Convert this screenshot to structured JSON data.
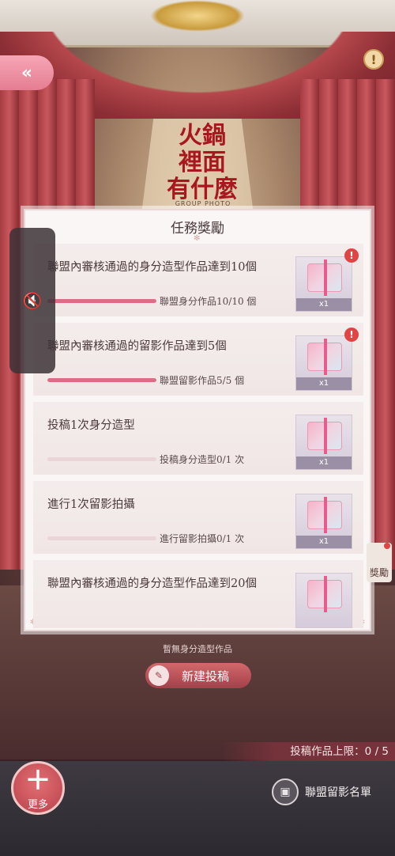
{
  "header": {
    "back_icon": "«",
    "info_icon": "!"
  },
  "logo": {
    "line1": "火鍋",
    "line2": "裡面",
    "line3": "有什麼",
    "sub": "GROUP PHOTO"
  },
  "panel": {
    "title": "任務獎勵",
    "tasks": [
      {
        "title": "聯盟內審核通過的身分造型作品達到10個",
        "progress_label": "聯盟身分作品10/10 個",
        "progress": 1.0,
        "reward_qty": "x1",
        "alert": "!"
      },
      {
        "title": "聯盟內審核通過的留影作品達到5個",
        "progress_label": "聯盟留影作品5/5 個",
        "progress": 1.0,
        "reward_qty": "x1",
        "alert": "!"
      },
      {
        "title": "投稿1次身分造型",
        "progress_label": "投稿身分造型0/1 次",
        "progress": 0.0,
        "reward_qty": "x1"
      },
      {
        "title": "進行1次留影拍攝",
        "progress_label": "進行留影拍攝0/1 次",
        "progress": 0.0,
        "reward_qty": "x1"
      },
      {
        "title": "聯盟內審核通過的身分造型作品達到20個",
        "progress_label": "",
        "progress": 0.0,
        "reward_qty": ""
      }
    ]
  },
  "reward_tag": "獎勵",
  "empty_text": "暫無身分造型作品",
  "new_submit_label": "新建投稿",
  "limit_text": "投稿作品上限：0 / 5",
  "more_label": "更多",
  "union_list_label": "聯盟留影名單"
}
